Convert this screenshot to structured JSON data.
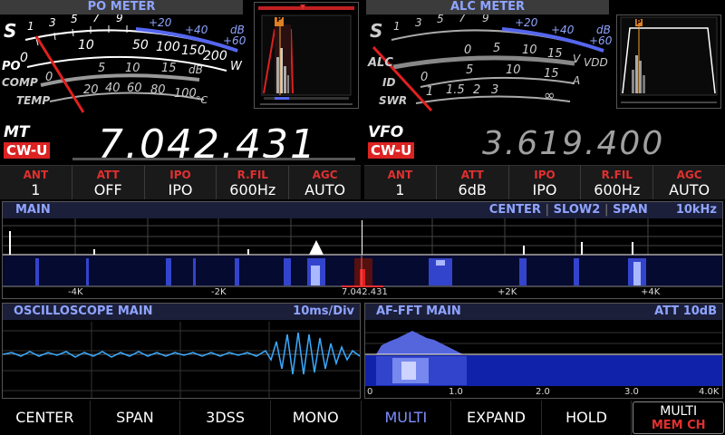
{
  "po_meter": {
    "title": "PO METER",
    "scales": {
      "s_label": "S",
      "s_ticks": [
        "1",
        "3",
        "5",
        "7",
        "9",
        "+20",
        "+40",
        "dB",
        "+60"
      ],
      "po_label": "PO",
      "po_ticks": [
        "0",
        "10",
        "50",
        "100",
        "150",
        "200",
        "250",
        "W"
      ],
      "comp_label": "COMP",
      "comp_ticks": [
        "0",
        "5",
        "10",
        "15",
        "dB"
      ],
      "temp_label": "TEMP",
      "temp_ticks": [
        "20",
        "40",
        "60",
        "80",
        "100",
        "°C"
      ]
    },
    "filter_marker": "P"
  },
  "alc_meter": {
    "title": "ALC METER",
    "scales": {
      "s_label": "S",
      "s_ticks": [
        "1",
        "3",
        "5",
        "7",
        "9",
        "+20",
        "+40",
        "dB",
        "+60"
      ],
      "alc_label": "ALC",
      "vdd_ticks": [
        "0",
        "5",
        "10",
        "15",
        "V",
        "VDD"
      ],
      "id_label": "ID",
      "id_ticks": [
        "0",
        "5",
        "10",
        "15",
        "A"
      ],
      "swr_label": "SWR",
      "swr_ticks": [
        "1",
        "1.5",
        "2",
        "3",
        "∞"
      ]
    },
    "filter_marker": "P"
  },
  "main_vfo": {
    "label": "MT",
    "mode": "CW-U",
    "frequency": "7.042.431"
  },
  "sub_vfo": {
    "label": "VFO",
    "mode": "CW-U",
    "frequency": "3.619.400"
  },
  "main_status": [
    {
      "label": "ANT",
      "value": "1"
    },
    {
      "label": "ATT",
      "value": "OFF"
    },
    {
      "label": "IPO",
      "value": "IPO"
    },
    {
      "label": "R.FIL",
      "value": "600Hz"
    },
    {
      "label": "AGC",
      "value": "AUTO"
    }
  ],
  "sub_status": [
    {
      "label": "ANT",
      "value": "1"
    },
    {
      "label": "ATT",
      "value": "6dB"
    },
    {
      "label": "IPO",
      "value": "IPO"
    },
    {
      "label": "R.FIL",
      "value": "600Hz"
    },
    {
      "label": "AGC",
      "value": "AUTO"
    }
  ],
  "spectrum": {
    "title": "MAIN",
    "mode": "CENTER",
    "speed": "SLOW2",
    "span_label": "SPAN",
    "span_value": "10kHz",
    "ticks": [
      "-4K",
      "-2K",
      "7.042.431",
      "+2K",
      "+4K"
    ]
  },
  "oscilloscope": {
    "title": "OSCILLOSCOPE MAIN",
    "timebase": "10ms/Div"
  },
  "af_fft": {
    "title": "AF-FFT MAIN",
    "att": "ATT 10dB",
    "ticks": [
      "0",
      "1.0",
      "2.0",
      "3.0",
      "4.0K"
    ]
  },
  "bottom_menu": {
    "center": "CENTER",
    "span": "SPAN",
    "dss": "3DSS",
    "mono": "MONO",
    "multi": "MULTI",
    "expand": "EXPAND",
    "hold": "HOLD",
    "multi_memch_top": "MULTI",
    "multi_memch_bottom": "MEM CH"
  },
  "colors": {
    "accent_blue": "#8fa4ff",
    "mode_red": "#d22222",
    "status_label_red": "#e03030",
    "scope_trace": "#3aaaff",
    "spectrum_blue": "#2233bb"
  }
}
